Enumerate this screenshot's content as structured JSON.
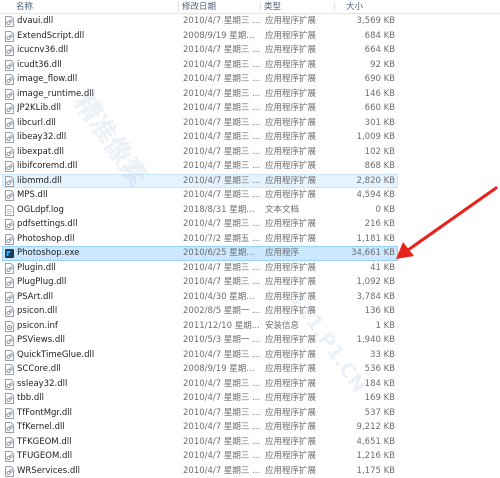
{
  "columns": {
    "name": "名称",
    "date": "修改日期",
    "type": "类型",
    "size": "大小"
  },
  "files": [
    {
      "name": "dvaui.dll",
      "date": "2010/4/7 星期三 ...",
      "type": "应用程序扩展",
      "size": "3,569 KB",
      "icon": "dll-file-icon"
    },
    {
      "name": "ExtendScript.dll",
      "date": "2008/9/19 星期...",
      "type": "应用程序扩展",
      "size": "684 KB",
      "icon": "dll-file-icon"
    },
    {
      "name": "icucnv36.dll",
      "date": "2010/4/7 星期三 ...",
      "type": "应用程序扩展",
      "size": "664 KB",
      "icon": "dll-file-icon"
    },
    {
      "name": "icudt36.dll",
      "date": "2010/4/7 星期三 ...",
      "type": "应用程序扩展",
      "size": "92 KB",
      "icon": "dll-file-icon"
    },
    {
      "name": "image_flow.dll",
      "date": "2010/4/7 星期三 ...",
      "type": "应用程序扩展",
      "size": "690 KB",
      "icon": "dll-file-icon"
    },
    {
      "name": "image_runtime.dll",
      "date": "2010/4/7 星期三 ...",
      "type": "应用程序扩展",
      "size": "146 KB",
      "icon": "dll-file-icon"
    },
    {
      "name": "JP2KLib.dll",
      "date": "2010/4/7 星期三 ...",
      "type": "应用程序扩展",
      "size": "660 KB",
      "icon": "dll-file-icon"
    },
    {
      "name": "libcurl.dll",
      "date": "2010/4/7 星期三 ...",
      "type": "应用程序扩展",
      "size": "301 KB",
      "icon": "dll-file-icon"
    },
    {
      "name": "libeay32.dll",
      "date": "2010/4/7 星期三 ...",
      "type": "应用程序扩展",
      "size": "1,009 KB",
      "icon": "dll-file-icon"
    },
    {
      "name": "libexpat.dll",
      "date": "2010/4/7 星期三 ...",
      "type": "应用程序扩展",
      "size": "102 KB",
      "icon": "dll-file-icon"
    },
    {
      "name": "libifcoremd.dll",
      "date": "2010/4/7 星期三 ...",
      "type": "应用程序扩展",
      "size": "868 KB",
      "icon": "dll-file-icon"
    },
    {
      "name": "libmmd.dll",
      "date": "2010/4/7 星期三 ...",
      "type": "应用程序扩展",
      "size": "2,820 KB",
      "icon": "dll-file-icon",
      "state": "hovered"
    },
    {
      "name": "MPS.dll",
      "date": "2010/4/7 星期三 ...",
      "type": "应用程序扩展",
      "size": "4,594 KB",
      "icon": "dll-file-icon"
    },
    {
      "name": "OGLdpf.log",
      "date": "2018/8/31 星期...",
      "type": "文本文档",
      "size": "0 KB",
      "icon": "text-file-icon"
    },
    {
      "name": "pdfsettings.dll",
      "date": "2010/4/7 星期三 ...",
      "type": "应用程序扩展",
      "size": "216 KB",
      "icon": "dll-file-icon"
    },
    {
      "name": "Photoshop.dll",
      "date": "2010/7/2 星期五 ...",
      "type": "应用程序扩展",
      "size": "1,181 KB",
      "icon": "dll-file-icon"
    },
    {
      "name": "Photoshop.exe",
      "date": "2010/6/25 星期...",
      "type": "应用程序",
      "size": "34,661 KB",
      "icon": "photoshop-app-icon",
      "state": "selected"
    },
    {
      "name": "Plugin.dll",
      "date": "2010/4/7 星期三 ...",
      "type": "应用程序扩展",
      "size": "41 KB",
      "icon": "dll-file-icon"
    },
    {
      "name": "PlugPlug.dll",
      "date": "2010/4/7 星期三 ...",
      "type": "应用程序扩展",
      "size": "1,092 KB",
      "icon": "dll-file-icon"
    },
    {
      "name": "PSArt.dll",
      "date": "2010/4/30 星期...",
      "type": "应用程序扩展",
      "size": "3,784 KB",
      "icon": "dll-file-icon"
    },
    {
      "name": "psicon.dll",
      "date": "2002/8/5 星期一 ...",
      "type": "应用程序扩展",
      "size": "136 KB",
      "icon": "dll-file-icon"
    },
    {
      "name": "psicon.inf",
      "date": "2011/12/10 星期...",
      "type": "安装信息",
      "size": "1 KB",
      "icon": "setup-info-icon"
    },
    {
      "name": "PSViews.dll",
      "date": "2010/5/3 星期一 ...",
      "type": "应用程序扩展",
      "size": "1,940 KB",
      "icon": "dll-file-icon"
    },
    {
      "name": "QuickTimeGlue.dll",
      "date": "2010/4/7 星期三 ...",
      "type": "应用程序扩展",
      "size": "33 KB",
      "icon": "dll-file-icon"
    },
    {
      "name": "SCCore.dll",
      "date": "2008/9/19 星期...",
      "type": "应用程序扩展",
      "size": "536 KB",
      "icon": "dll-file-icon"
    },
    {
      "name": "ssleay32.dll",
      "date": "2010/4/7 星期三 ...",
      "type": "应用程序扩展",
      "size": "184 KB",
      "icon": "dll-file-icon"
    },
    {
      "name": "tbb.dll",
      "date": "2010/4/7 星期三 ...",
      "type": "应用程序扩展",
      "size": "169 KB",
      "icon": "dll-file-icon"
    },
    {
      "name": "TfFontMgr.dll",
      "date": "2010/4/7 星期三 ...",
      "type": "应用程序扩展",
      "size": "537 KB",
      "icon": "dll-file-icon"
    },
    {
      "name": "TfKernel.dll",
      "date": "2010/4/7 星期三 ...",
      "type": "应用程序扩展",
      "size": "9,212 KB",
      "icon": "dll-file-icon"
    },
    {
      "name": "TFKGEOM.dll",
      "date": "2010/4/7 星期三 ...",
      "type": "应用程序扩展",
      "size": "4,651 KB",
      "icon": "dll-file-icon"
    },
    {
      "name": "TFUGEOM.dll",
      "date": "2010/4/7 星期三 ...",
      "type": "应用程序扩展",
      "size": "1,216 KB",
      "icon": "dll-file-icon"
    },
    {
      "name": "WRServices.dll",
      "date": "2010/4/7 星期三 ...",
      "type": "应用程序扩展",
      "size": "1,175 KB",
      "icon": "dll-file-icon"
    }
  ],
  "watermark": {
    "text_main": "精准像素",
    "text_ip": "111.P1.CN"
  },
  "colors": {
    "selection_bg": "#cce8ff",
    "selection_border": "#99d1ff",
    "hover_bg": "#e5f3ff",
    "arrow": "#e8231c",
    "photoshop_icon_bg": "#1c3b5f",
    "photoshop_icon_fg": "#31a8ff"
  }
}
